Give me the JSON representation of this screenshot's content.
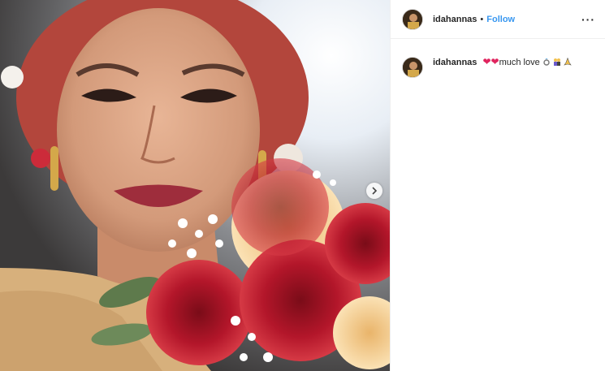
{
  "post": {
    "username": "idahannas",
    "separator": "•",
    "follow_label": "Follow",
    "more_label": "···",
    "caption": {
      "username": "idahannas",
      "text": "much love"
    },
    "icons": {
      "avatar": "profile-avatar",
      "next": "chevron-right-icon",
      "more": "more-options-icon"
    },
    "colors": {
      "follow": "#3897f0",
      "heart": "#e0245e"
    }
  }
}
